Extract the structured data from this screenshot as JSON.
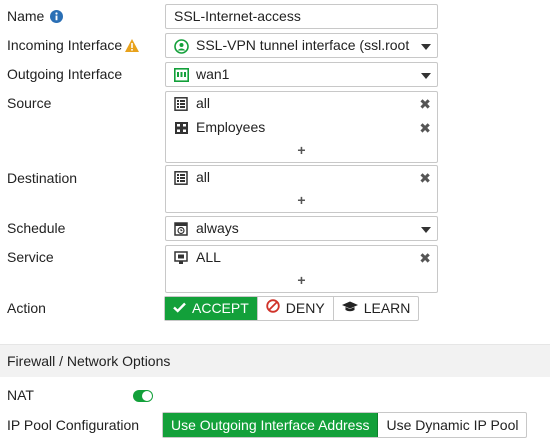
{
  "labels": {
    "name": "Name",
    "incoming": "Incoming Interface",
    "outgoing": "Outgoing Interface",
    "source": "Source",
    "destination": "Destination",
    "schedule": "Schedule",
    "service": "Service",
    "action": "Action",
    "nat": "NAT",
    "ip_pool": "IP Pool Configuration"
  },
  "fields": {
    "name_value": "SSL-Internet-access",
    "incoming_value": "SSL-VPN tunnel interface (ssl.root",
    "outgoing_value": "wan1",
    "source_items": [
      "all",
      "Employees"
    ],
    "destination_items": [
      "all"
    ],
    "schedule_value": "always",
    "service_items": [
      "ALL"
    ],
    "add_symbol": "+",
    "remove_symbol": "✖"
  },
  "actions": {
    "accept": "ACCEPT",
    "deny": "DENY",
    "learn": "LEARN",
    "selected": "accept"
  },
  "section_title": "Firewall / Network Options",
  "nat_enabled": true,
  "ip_pool": {
    "outgoing": "Use Outgoing Interface Address",
    "dynamic": "Use Dynamic IP Pool",
    "selected": "outgoing"
  },
  "colors": {
    "accent_green": "#13a03a",
    "info_blue": "#2a6fb5",
    "warning_orange": "#e8a21c",
    "deny_red": "#d0332a"
  }
}
